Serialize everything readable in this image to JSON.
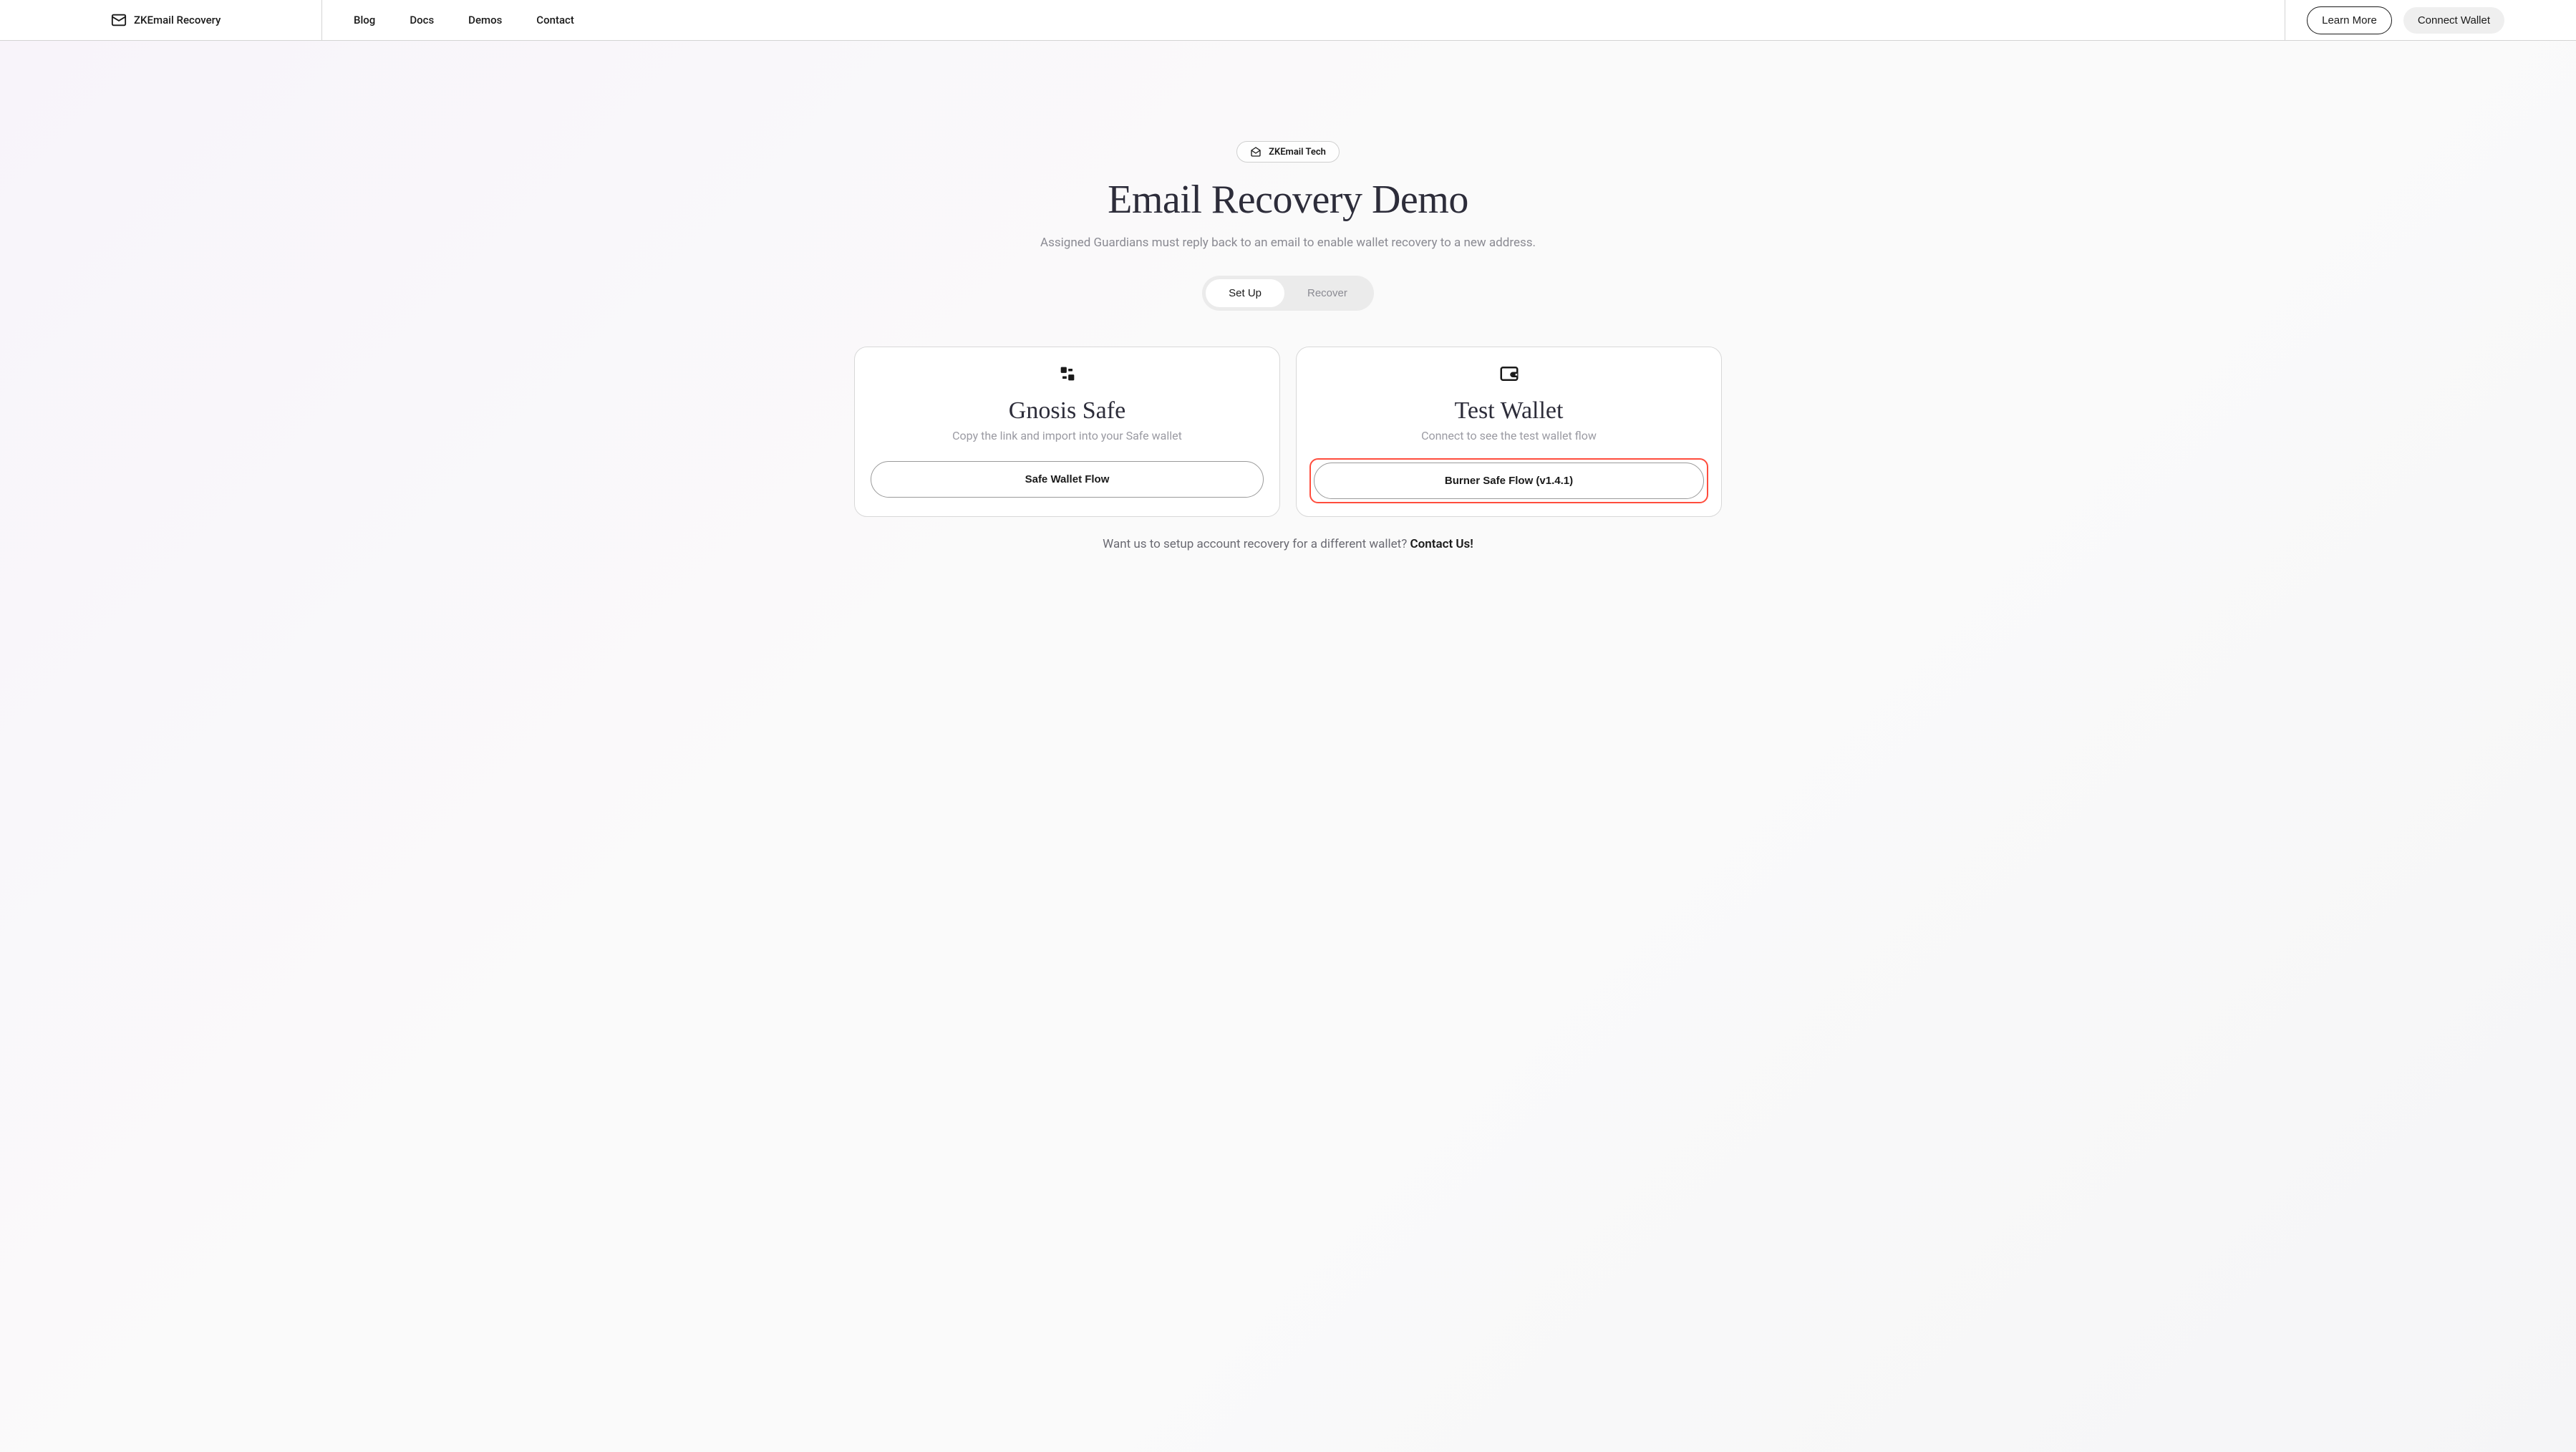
{
  "header": {
    "brand": "ZKEmail Recovery",
    "nav": [
      "Blog",
      "Docs",
      "Demos",
      "Contact"
    ],
    "learnMore": "Learn More",
    "connectWallet": "Connect Wallet"
  },
  "hero": {
    "badge": "ZKEmail Tech",
    "title": "Email Recovery Demo",
    "subtitle": "Assigned Guardians must reply back to an email to enable wallet recovery to a new address."
  },
  "toggle": {
    "setup": "Set Up",
    "recover": "Recover"
  },
  "cards": {
    "gnosis": {
      "title": "Gnosis Safe",
      "subtitle": "Copy the link and import into your Safe wallet",
      "button": "Safe Wallet Flow"
    },
    "test": {
      "title": "Test Wallet",
      "subtitle": "Connect to see the test wallet flow",
      "button": "Burner Safe Flow (v1.4.1)"
    }
  },
  "footer": {
    "prefix": "Want us to setup account recovery for a different wallet? ",
    "cta": "Contact Us!"
  }
}
